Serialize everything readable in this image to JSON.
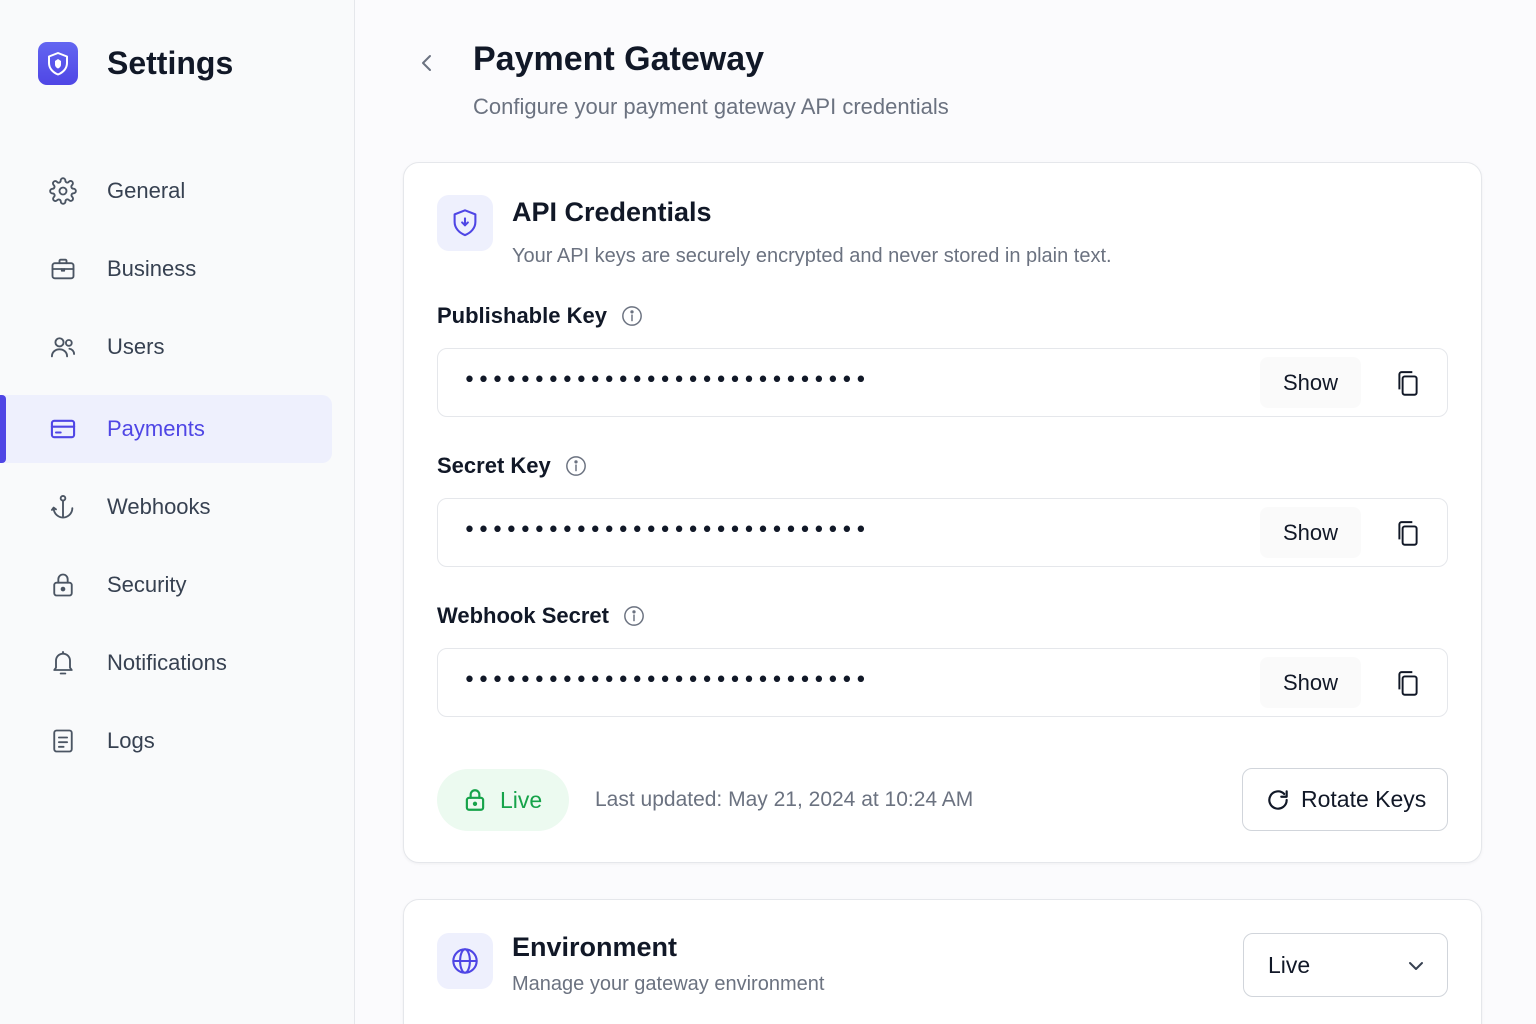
{
  "app": {
    "title": "Settings"
  },
  "sidebar": {
    "items": [
      {
        "label": "General",
        "icon": "gear-icon",
        "active": false
      },
      {
        "label": "Business",
        "icon": "briefcase-icon",
        "active": false
      },
      {
        "label": "Users",
        "icon": "users-icon",
        "active": false
      },
      {
        "label": "Payments",
        "icon": "credit-card-icon",
        "active": true
      },
      {
        "label": "Webhooks",
        "icon": "anchor-icon",
        "active": false
      },
      {
        "label": "Security",
        "icon": "lock-icon",
        "active": false
      },
      {
        "label": "Notifications",
        "icon": "bell-icon",
        "active": false
      },
      {
        "label": "Logs",
        "icon": "document-icon",
        "active": false
      }
    ]
  },
  "header": {
    "title": "Payment Gateway",
    "subtitle": "Configure your payment gateway API credentials"
  },
  "credentials": {
    "title": "API Credentials",
    "description": "Your API keys are securely encrypted and never stored in plain text.",
    "fields": [
      {
        "label": "Publishable Key",
        "masked": "•••••••••••••••••••••••••••••",
        "show_label": "Show"
      },
      {
        "label": "Secret Key",
        "masked": "•••••••••••••••••••••••••••••",
        "show_label": "Show"
      },
      {
        "label": "Webhook Secret",
        "masked": "•••••••••••••••••••••••••••••",
        "show_label": "Show"
      }
    ],
    "status_badge": "Live",
    "last_updated": "Last updated: May 21, 2024 at 10:24 AM",
    "rotate_label": "Rotate Keys"
  },
  "environment": {
    "title": "Environment",
    "description": "Manage your gateway environment",
    "selected": "Live"
  },
  "colors": {
    "accent": "#4f46e5",
    "accent_bg": "#eef0fd",
    "live_green": "#16a34a",
    "live_bg": "#ecfaf0",
    "muted_text": "#6b7280"
  }
}
